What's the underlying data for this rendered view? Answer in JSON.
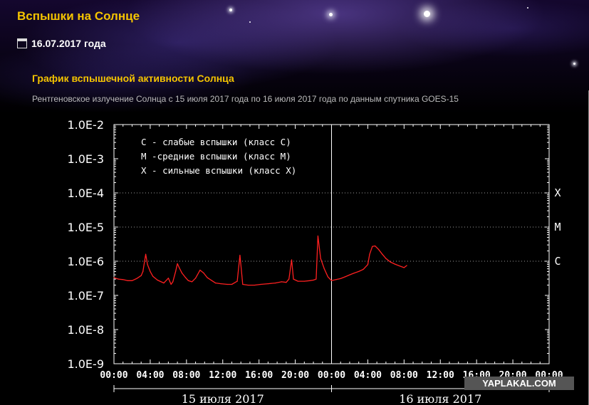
{
  "header": {
    "site_title": "Вспышки на Солнце",
    "date": "16.07.2017 года",
    "date_icon": "calendar-icon"
  },
  "section": {
    "heading": "График вспышечной активности Солнца",
    "description": "Рентгеновское излучение Солнца с 15 июля 2017 года по 16 июля 2017 года по данным спутника GOES-15"
  },
  "watermark": "YAPLAKAL.COM",
  "colors": {
    "title": "#f5c400",
    "series": "#ff2020",
    "axes": "#ffffff",
    "grid": "#9a9a9a"
  },
  "chart_data": {
    "type": "line",
    "y_scale": "log",
    "ylim": [
      1e-09,
      0.01
    ],
    "y_ticks": [
      {
        "value": 1e-09,
        "label": "1.0E-9"
      },
      {
        "value": 1e-08,
        "label": "1.0E-8"
      },
      {
        "value": 1e-07,
        "label": "1.0E-7"
      },
      {
        "value": 1e-06,
        "label": "1.0E-6"
      },
      {
        "value": 1e-05,
        "label": "1.0E-5"
      },
      {
        "value": 0.0001,
        "label": "1.0E-4"
      },
      {
        "value": 0.001,
        "label": "1.0E-3"
      },
      {
        "value": 0.01,
        "label": "1.0E-2"
      }
    ],
    "x_unit": "hours since 15 июля 2017 00:00 UT",
    "xlim": [
      0,
      48
    ],
    "x_tick_labels": [
      "00:00",
      "04:00",
      "08:00",
      "12:00",
      "16:00",
      "20:00",
      "00:00",
      "04:00",
      "08:00",
      "12:00",
      "16:00",
      "20:00",
      "00:00"
    ],
    "day_labels": [
      {
        "label": "15 июля 2017",
        "start_hour": 0
      },
      {
        "label": "16 июля 2017",
        "start_hour": 24
      }
    ],
    "day_divider_hour": 24,
    "class_thresholds": [
      {
        "label": "X",
        "value": 0.0001
      },
      {
        "label": "M",
        "value": 1e-05
      },
      {
        "label": "C",
        "value": 1e-06
      }
    ],
    "legend": [
      "C - слабые вспышки (класс C)",
      "M -средние вспышки (класс M)",
      "X - сильные вспышки (класс X)"
    ],
    "legend_placement": "top-left",
    "series": [
      {
        "x": [
          0,
          0.5,
          1,
          1.5,
          2,
          2.5,
          3,
          3.2,
          3.5,
          3.7,
          4.0,
          4.3,
          4.8,
          5.5,
          6.0,
          6.3,
          6.5,
          6.8,
          7.0,
          7.2,
          7.5,
          7.9,
          8.2,
          8.6,
          9.0,
          9.5,
          9.9,
          10.3,
          10.8,
          11.2,
          11.8,
          12.5,
          13.0,
          13.6,
          13.9,
          14.2,
          14.8,
          15.5,
          16.2,
          17.0,
          17.8,
          18.5,
          19.0,
          19.3,
          19.6,
          19.8,
          20.3,
          21.0,
          21.6,
          22.0,
          22.3,
          22.5,
          22.8,
          23.2,
          23.6,
          24.0,
          24.5,
          25.0,
          25.5,
          26.0,
          26.5,
          27.0,
          27.5,
          28.0,
          28.2,
          28.5,
          28.8,
          29.2,
          29.6,
          30.0,
          30.5,
          31.0,
          31.5,
          32.0,
          32.3
        ],
        "y": [
          3.3e-07,
          3e-07,
          2.9e-07,
          2.7e-07,
          2.7e-07,
          3.1e-07,
          3.8e-07,
          5e-07,
          1.6e-06,
          8e-07,
          5e-07,
          3.6e-07,
          2.8e-07,
          2.3e-07,
          3.2e-07,
          2.1e-07,
          2.5e-07,
          5e-07,
          8.5e-07,
          6.5e-07,
          4.5e-07,
          3.3e-07,
          2.7e-07,
          2.5e-07,
          3.2e-07,
          5.5e-07,
          4.5e-07,
          3.3e-07,
          2.7e-07,
          2.3e-07,
          2.2e-07,
          2.1e-07,
          2.1e-07,
          2.6e-07,
          1.5e-06,
          2.1e-07,
          2e-07,
          2e-07,
          2.1e-07,
          2.2e-07,
          2.3e-07,
          2.5e-07,
          2.4e-07,
          3e-07,
          1.1e-06,
          3e-07,
          2.6e-07,
          2.6e-07,
          2.7e-07,
          2.8e-07,
          3e-07,
          5.5e-06,
          1.2e-06,
          6e-07,
          3.5e-07,
          2.7e-07,
          2.9e-07,
          3.1e-07,
          3.5e-07,
          4e-07,
          4.5e-07,
          5e-07,
          5.8e-07,
          8e-07,
          1.6e-06,
          2.7e-06,
          2.8e-06,
          2.2e-06,
          1.6e-06,
          1.2e-06,
          9.5e-07,
          8.2e-07,
          7.3e-07,
          6.5e-07,
          7.5e-07
        ]
      }
    ]
  }
}
